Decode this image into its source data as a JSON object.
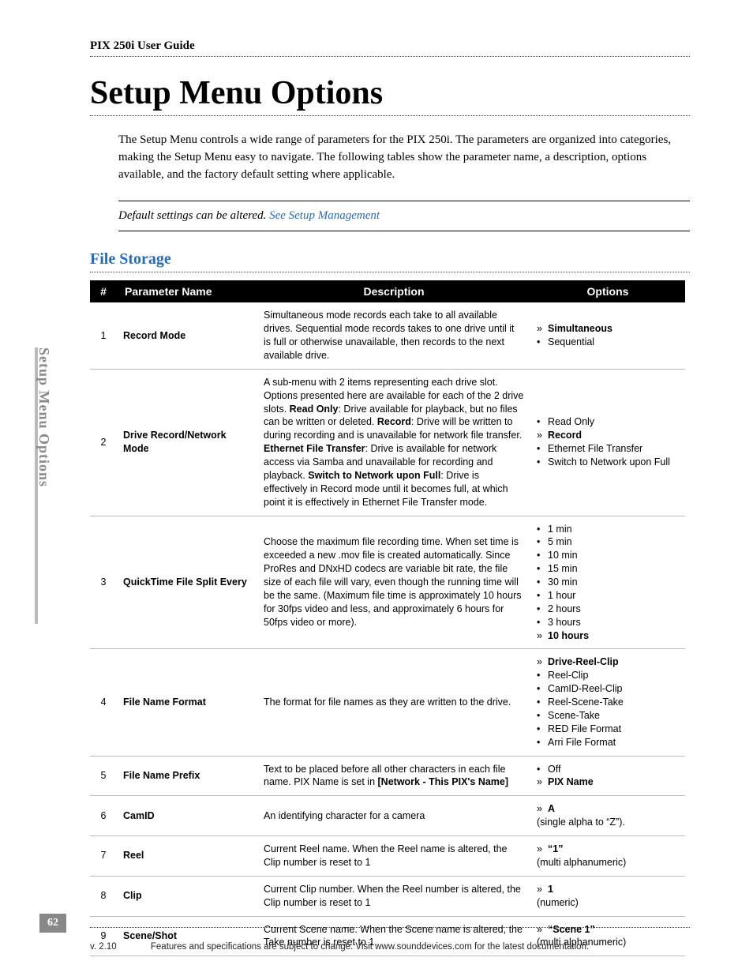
{
  "running_head": "PIX 250i User Guide",
  "title": "Setup Menu Options",
  "intro": "The Setup Menu controls a wide range of parameters for the PIX 250i. The parameters are organized into categories, making the Setup Menu easy to navigate. The following tables show the parameter name, a description, options available, and the factory default setting where applicable.",
  "note_plain": "Default settings can be altered. ",
  "note_link": "See Setup Management",
  "section": "File Storage",
  "columns": {
    "num": "#",
    "name": "Parameter Name",
    "desc": "Description",
    "opts": "Options"
  },
  "side_tab": "Setup Menu Options",
  "page_number": "62",
  "footer_version": "v. 2.10",
  "footer_text": "Features and specifications are subject to change. Visit www.sounddevices.com for the latest documentation.",
  "rows": [
    {
      "num": "1",
      "name": "Record Mode",
      "desc_html": "Simultaneous mode records each take to all available drives. Sequential mode records takes to one drive until it is full or otherwise unavailable, then records to the next available drive.",
      "options": [
        {
          "label": "Simultaneous",
          "default": true
        },
        {
          "label": "Sequential",
          "default": false
        }
      ]
    },
    {
      "num": "2",
      "name": "Drive Record/Network Mode",
      "desc_html": "A sub-menu with 2 items representing each drive slot. Options presented here are available for each of the 2 drive slots. <b>Read Only</b>: Drive available for playback, but no files can be written or deleted. <b>Record</b>: Drive will be written to during recording and is unavailable for network file transfer. <b>Ethernet File Transfer</b>: Drive is available for network access via Samba and unavailable for recording and playback. <b>Switch to Network upon Full</b>: Drive is effectively in Record mode until it becomes full, at which point it is effectively in Ethernet File Transfer mode.",
      "options": [
        {
          "label": "Read Only",
          "default": false
        },
        {
          "label": "Record",
          "default": true
        },
        {
          "label": "Ethernet File Transfer",
          "default": false
        },
        {
          "label": "Switch to Network upon Full",
          "default": false
        }
      ]
    },
    {
      "num": "3",
      "name": "QuickTime File Split Every",
      "desc_html": "Choose the maximum file recording time. When set time is exceeded a new .mov file is created automatically. Since ProRes and DNxHD codecs are variable bit rate, the file size of each file will vary, even though the running time will be the same. (Maximum file time is approximately 10 hours for 30fps video and less, and approximately 6 hours for 50fps video or more).",
      "options": [
        {
          "label": "1 min",
          "default": false
        },
        {
          "label": "5 min",
          "default": false
        },
        {
          "label": "10 min",
          "default": false
        },
        {
          "label": "15 min",
          "default": false
        },
        {
          "label": "30 min",
          "default": false
        },
        {
          "label": "1 hour",
          "default": false
        },
        {
          "label": "2 hours",
          "default": false
        },
        {
          "label": "3 hours",
          "default": false
        },
        {
          "label": "10 hours",
          "default": true
        }
      ]
    },
    {
      "num": "4",
      "name": "File Name Format",
      "desc_html": "The format for file names as they are written to the drive.",
      "options": [
        {
          "label": "Drive-Reel-Clip",
          "default": true
        },
        {
          "label": "Reel-Clip",
          "default": false
        },
        {
          "label": "CamID-Reel-Clip",
          "default": false
        },
        {
          "label": "Reel-Scene-Take",
          "default": false
        },
        {
          "label": "Scene-Take",
          "default": false
        },
        {
          "label": "RED File Format",
          "default": false
        },
        {
          "label": "Arri File Format",
          "default": false
        }
      ]
    },
    {
      "num": "5",
      "name": "File Name Prefix",
      "desc_html": "Text to be placed before all other characters in each file name. PIX Name is set in <b>[Network - This PIX's Name]</b>",
      "options": [
        {
          "label": "Off",
          "default": false
        },
        {
          "label": "PIX Name",
          "default": true
        }
      ]
    },
    {
      "num": "6",
      "name": "CamID",
      "desc_html": "An identifying character for a camera",
      "options": [
        {
          "label": "A",
          "default": true
        },
        {
          "label": "(single alpha to “Z”).",
          "raw": true
        }
      ]
    },
    {
      "num": "7",
      "name": "Reel",
      "desc_html": "Current Reel name. When the Reel name is altered, the Clip number is reset to 1",
      "options": [
        {
          "label": "“1”",
          "default": true
        },
        {
          "label": "(multi alphanumeric)",
          "raw": true
        }
      ]
    },
    {
      "num": "8",
      "name": "Clip",
      "desc_html": "Current Clip number. When the Reel number is altered, the Clip number is reset to 1",
      "options": [
        {
          "label": "1",
          "default": true
        },
        {
          "label": "(numeric)",
          "raw": true
        }
      ]
    },
    {
      "num": "9",
      "name": "Scene/Shot",
      "desc_html": "Current Scene name. When the Scene name is altered, the Take number is reset to 1.",
      "options": [
        {
          "label": "“Scene 1”",
          "default": true
        },
        {
          "label": "(multi alphanumeric)",
          "raw": true
        }
      ]
    }
  ]
}
